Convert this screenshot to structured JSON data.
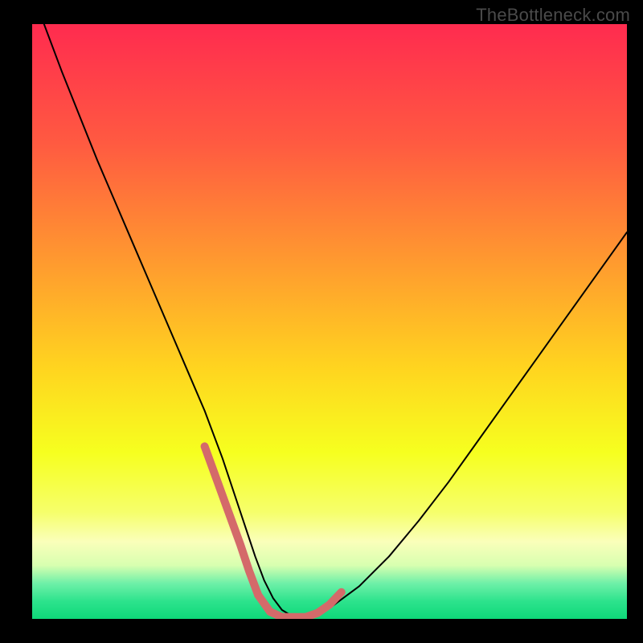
{
  "watermark": {
    "text": "TheBottleneck.com"
  },
  "chart_data": {
    "type": "line",
    "title": "",
    "xlabel": "",
    "ylabel": "",
    "xlim": [
      0,
      100
    ],
    "ylim": [
      0,
      100
    ],
    "grid": false,
    "background_gradient_stops": [
      {
        "offset": 0.0,
        "color": "#ff2b4f"
      },
      {
        "offset": 0.2,
        "color": "#ff5a41"
      },
      {
        "offset": 0.4,
        "color": "#ff9a2f"
      },
      {
        "offset": 0.58,
        "color": "#ffd51f"
      },
      {
        "offset": 0.72,
        "color": "#f6ff1f"
      },
      {
        "offset": 0.82,
        "color": "#f6ff6a"
      },
      {
        "offset": 0.87,
        "color": "#faffba"
      },
      {
        "offset": 0.91,
        "color": "#d8ffb0"
      },
      {
        "offset": 0.94,
        "color": "#6ff0a8"
      },
      {
        "offset": 0.97,
        "color": "#2de38d"
      },
      {
        "offset": 1.0,
        "color": "#0ed879"
      }
    ],
    "series": [
      {
        "name": "bottleneck-curve",
        "stroke": "#000000",
        "stroke_width": 2,
        "x": [
          2,
          5,
          8,
          11,
          14,
          17,
          20,
          23,
          26,
          29,
          32,
          34,
          36,
          37.5,
          39,
          40.5,
          42,
          44,
          47,
          50,
          55,
          60,
          65,
          70,
          75,
          80,
          85,
          90,
          95,
          100
        ],
        "y": [
          100,
          92,
          84.5,
          77,
          70,
          63,
          56,
          49,
          42,
          35,
          27,
          21,
          15,
          10.5,
          6.5,
          3.5,
          1.5,
          0.3,
          0.3,
          1.8,
          5.5,
          10.5,
          16.5,
          23,
          30,
          37,
          44,
          51,
          58,
          65
        ]
      },
      {
        "name": "marker-band-left",
        "stroke": "#d46a6a",
        "stroke_width": 10,
        "x": [
          29,
          31,
          33,
          35,
          36.5,
          38
        ],
        "y": [
          29,
          23.5,
          18,
          12.5,
          8,
          4
        ]
      },
      {
        "name": "marker-band-bottom",
        "stroke": "#d46a6a",
        "stroke_width": 10,
        "x": [
          38,
          40,
          42,
          44,
          46
        ],
        "y": [
          4,
          1.2,
          0.3,
          0.3,
          0.3
        ]
      },
      {
        "name": "marker-band-right",
        "stroke": "#d46a6a",
        "stroke_width": 10,
        "x": [
          46,
          48,
          50,
          52
        ],
        "y": [
          0.3,
          1,
          2.4,
          4.5
        ]
      }
    ]
  }
}
